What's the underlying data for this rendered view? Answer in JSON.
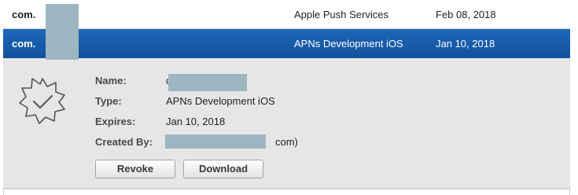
{
  "rows": [
    {
      "name": "com.",
      "type": "Apple Push Services",
      "expires": "Feb 08, 2018"
    },
    {
      "name": "com.",
      "type": "APNs Development iOS",
      "expires": "Jan 10, 2018"
    }
  ],
  "details": {
    "badge_icon": "certificate-badge-icon",
    "name_label": "Name:",
    "name_value": "c",
    "type_label": "Type:",
    "type_value": "APNs Development iOS",
    "expires_label": "Expires:",
    "expires_value": "Jan 10, 2018",
    "created_label": "Created By:",
    "created_value_suffix": "com)"
  },
  "buttons": {
    "revoke": "Revoke",
    "download": "Download"
  },
  "colors": {
    "selected_row": "#1a5fae",
    "details_bg": "#e6e6e6",
    "redaction": "#9eb6c2"
  }
}
